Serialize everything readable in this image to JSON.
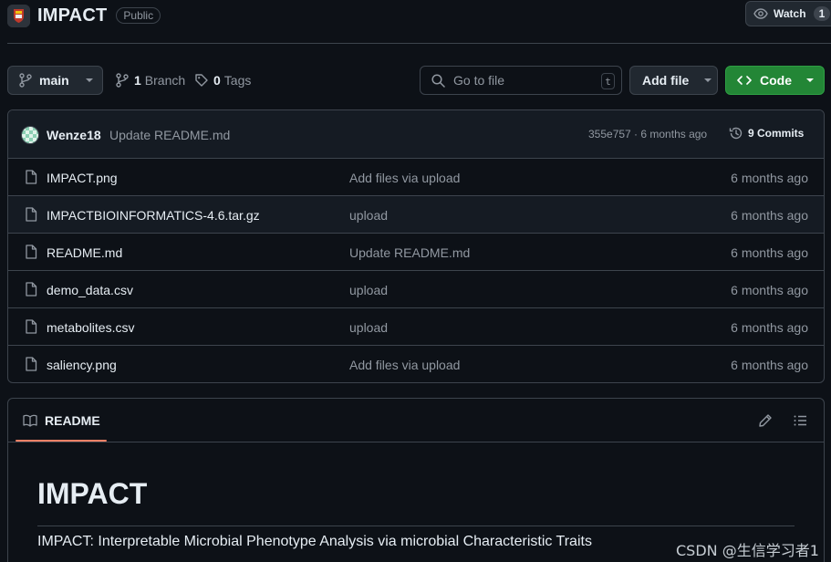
{
  "repo": {
    "name": "IMPACT",
    "visibility": "Public"
  },
  "watch": {
    "label": "Watch",
    "count": "1"
  },
  "toolbar": {
    "branch": "main",
    "branches_count": "1",
    "branches_label": "Branch",
    "tags_count": "0",
    "tags_label": "Tags",
    "search_placeholder": "Go to file",
    "search_shortcut": "t",
    "add_file": "Add file",
    "code": "Code"
  },
  "latest_commit": {
    "author": "Wenze18",
    "message": "Update README.md",
    "meta": "355e757 · 6 months ago",
    "commits_label": "9 Commits"
  },
  "files": [
    {
      "name": "IMPACT.png",
      "message": "Add files via upload",
      "date": "6 months ago"
    },
    {
      "name": "IMPACTBIOINFORMATICS-4.6.tar.gz",
      "message": "upload",
      "date": "6 months ago"
    },
    {
      "name": "README.md",
      "message": "Update README.md",
      "date": "6 months ago"
    },
    {
      "name": "demo_data.csv",
      "message": "upload",
      "date": "6 months ago"
    },
    {
      "name": "metabolites.csv",
      "message": "upload",
      "date": "6 months ago"
    },
    {
      "name": "saliency.png",
      "message": "Add files via upload",
      "date": "6 months ago"
    }
  ],
  "readme": {
    "tab_label": "README",
    "title": "IMPACT",
    "description": "IMPACT: Interpretable Microbial Phenotype Analysis via microbial Characteristic Traits"
  },
  "watermark": "CSDN @生信学习者1",
  "colors": {
    "accent_green": "#238636",
    "tab_underline": "#f78166",
    "background": "#0d1117"
  }
}
